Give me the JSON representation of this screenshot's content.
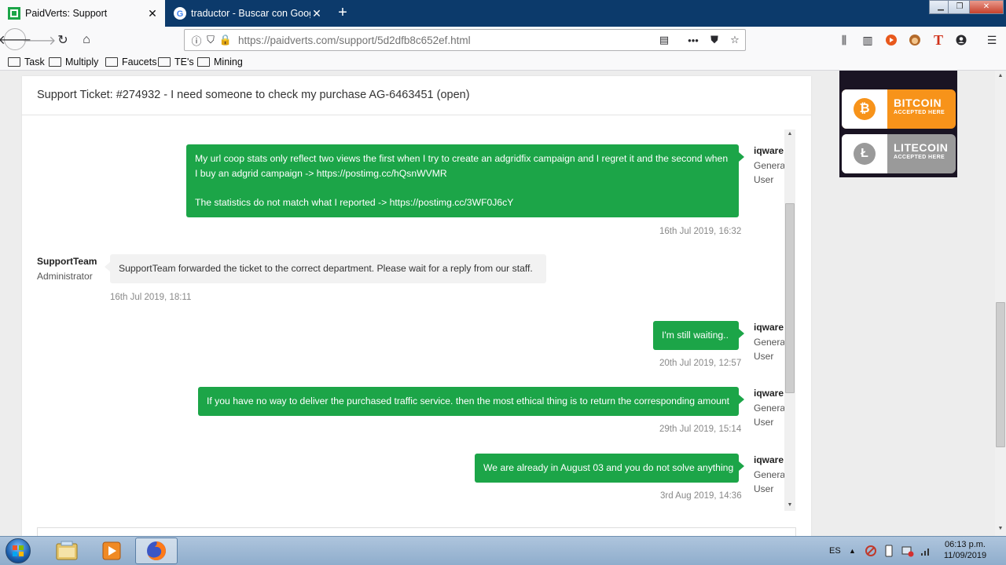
{
  "browser": {
    "tabs": [
      {
        "title": "PaidVerts: Support",
        "active": true
      },
      {
        "title": "traductor - Buscar con Google",
        "active": false
      }
    ],
    "url_domain": "https://paidverts.com",
    "url_path": "/support/5d2dfb8c652ef.html",
    "bookmarks": [
      "Task",
      "Multiply",
      "Faucets",
      "TE's",
      "Mining"
    ]
  },
  "ticket": {
    "title": "Support Ticket: #274932 - I need someone to check my purchase AG-6463451 (open)"
  },
  "messages": [
    {
      "from": "user",
      "author": "iqware",
      "role_line1": "General",
      "role_line2": "User",
      "lines": [
        "My url coop stats only reflect two views the first when I try to create an adgridfix campaign and I regret it and the second when",
        "I buy an adgrid campaign -> https://postimg.cc/hQsnWVMR",
        "",
        "The statistics do not match what I reported -> https://postimg.cc/3WF0J6cY"
      ],
      "timestamp": "16th Jul 2019, 16:32"
    },
    {
      "from": "staff",
      "author": "SupportTeam",
      "role_line1": "Administrator",
      "lines": [
        "SupportTeam forwarded the ticket to the correct department. Please wait for a reply from our staff."
      ],
      "timestamp": "16th Jul 2019, 18:11"
    },
    {
      "from": "user",
      "author": "iqware",
      "role_line1": "General",
      "role_line2": "User",
      "lines": [
        "I'm still waiting.."
      ],
      "timestamp": "20th Jul 2019, 12:57"
    },
    {
      "from": "user",
      "author": "iqware",
      "role_line1": "General",
      "role_line2": "User",
      "lines": [
        "If you have no way to deliver the purchased traffic service. then the most ethical thing is to return the corresponding amount"
      ],
      "timestamp": "29th Jul 2019, 15:14"
    },
    {
      "from": "user",
      "author": "iqware",
      "role_line1": "General",
      "role_line2": "User",
      "lines": [
        "We are already in August 03 and you do not solve anything"
      ],
      "timestamp": "3rd Aug 2019, 14:36"
    }
  ],
  "ad": {
    "bitcoin_title": "BITCOIN",
    "bitcoin_sub": "ACCEPTED HERE",
    "litecoin_title": "LITECOIN",
    "litecoin_sub": "ACCEPTED HERE",
    "colors": {
      "bitcoin": "#f7931a",
      "litecoin": "#9a9a9a"
    }
  },
  "taskbar": {
    "language": "ES",
    "time": "06:13 p.m.",
    "date": "11/09/2019"
  },
  "colors": {
    "user_bubble": "#1ca548",
    "staff_bubble": "#f2f2f2",
    "tab_strip": "#0c3a6b"
  }
}
